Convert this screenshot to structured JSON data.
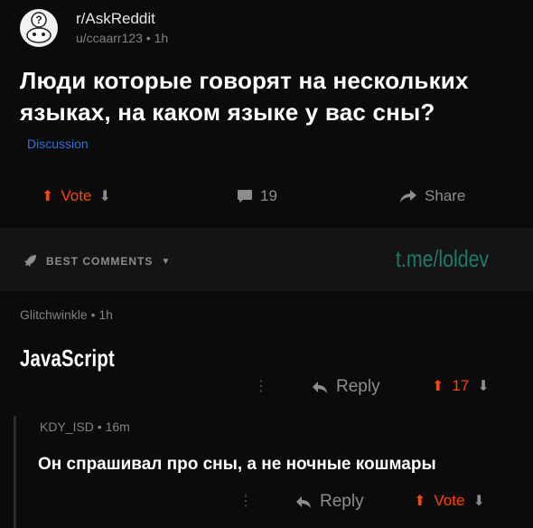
{
  "post": {
    "subreddit": "r/AskReddit",
    "meta": "u/ccaarr123 • 1h",
    "title": "Люди которые говорят на нескольких языках, на каком языке у вас сны?",
    "flair": "Discussion",
    "vote_label": "Vote",
    "comment_count": "19",
    "share_label": "Share",
    "avatar_icon": "reddit-alien-question-icon"
  },
  "comments_header": {
    "sort_label": "BEST COMMENTS",
    "watermark": "t.me/loldev"
  },
  "comments": [
    {
      "meta": "Glitchwinkle • 1h",
      "body": "JavaScript",
      "reply_label": "Reply",
      "score": "17"
    },
    {
      "meta": "KDY_ISD • 16m",
      "body": "Он спрашивал про сны, а не ночные кошмары",
      "reply_label": "Reply",
      "vote_label": "Vote"
    }
  ],
  "colors": {
    "background": "#0b0b0c",
    "upvote": "#ff4500",
    "flair": "#2d74d9",
    "watermark": "#1f7a67"
  }
}
